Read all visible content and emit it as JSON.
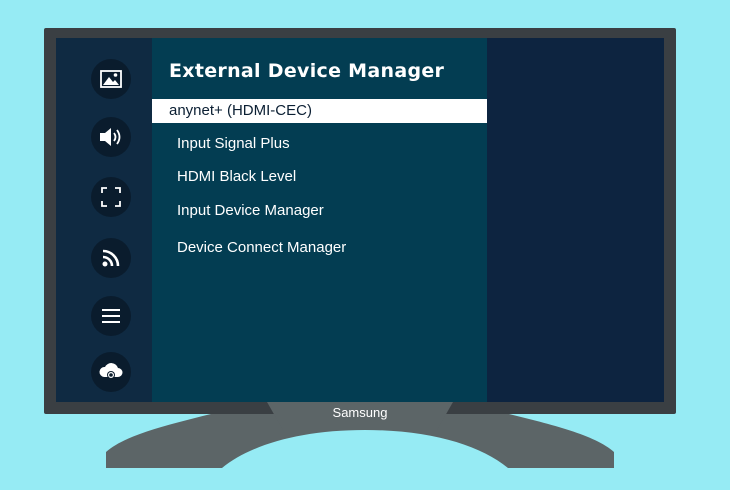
{
  "tv": {
    "brand": "Samsung"
  },
  "sidebar": {
    "icons": [
      {
        "name": "picture-icon"
      },
      {
        "name": "sound-icon"
      },
      {
        "name": "fullscreen-icon"
      },
      {
        "name": "broadcast-icon"
      },
      {
        "name": "menu-icon"
      },
      {
        "name": "support-icon"
      }
    ]
  },
  "menu": {
    "title": "External Device Manager",
    "items": [
      {
        "label": "anynet+ (HDMI-CEC)",
        "selected": true
      },
      {
        "label": "Input Signal Plus",
        "selected": false
      },
      {
        "label": "HDMI Black Level",
        "selected": false
      },
      {
        "label": "Input Device Manager",
        "selected": false
      },
      {
        "label": "Device Connect Manager",
        "selected": false
      }
    ]
  },
  "colors": {
    "background": "#96ebf4",
    "bezel": "#3a3f43",
    "stand": "#5c6567",
    "screen": "#0d2440",
    "rail": "#0f2a42",
    "menu_panel": "#033d52",
    "selected_bg": "#ffffff",
    "text": "#ffffff"
  }
}
